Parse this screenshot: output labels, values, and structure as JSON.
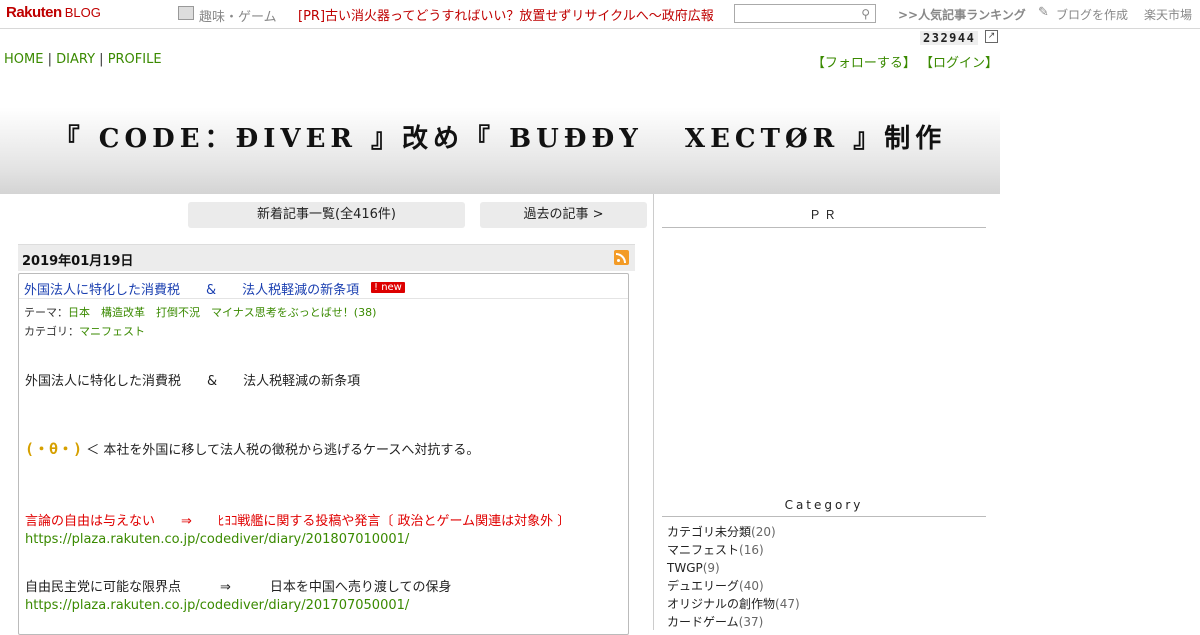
{
  "topbar": {
    "logo_main": "Rakuten",
    "logo_sub": "BLOG",
    "category_label": "趣味・ゲーム",
    "pr_link": "[PR]古い消火器ってどうすればいい？放置せずリサイクルへ～政府広報",
    "search_placeholder": "",
    "ranking_link": ">>人気記事ランキング",
    "create_link": "ブログを作成",
    "market_link": "楽天市場"
  },
  "counter": "232944",
  "nav": {
    "home": "HOME",
    "diary": "DIARY",
    "profile": "PROFILE",
    "sep": "|"
  },
  "account": {
    "follow": "【フォローする】",
    "login": "【ログイン】"
  },
  "banner": {
    "title": "『 CODE：ĐIVER 』改め『 BUĐĐY   XECTØR 』制作"
  },
  "buttons": {
    "new_list": "新着記事一覧(全416件)",
    "past": "過去の記事 >"
  },
  "entry": {
    "date": "2019年01月19日",
    "title": "外国法人に特化した消費税　　&　　法人税軽減の新条項",
    "new_badge": "! new",
    "theme_label": "テーマ：",
    "theme_value": "日本　構造改革　打倒不況　マイナス思考をぶっとばせ！(38)",
    "category_label": "カテゴリ：",
    "category_value": "マニフェスト",
    "body_heading": "外国法人に特化した消費税　　&　　法人税軽減の新条項",
    "face": "(・θ・)",
    "face_text": " ＜ 本社を外国に移して法人税の徴税から逃げるケースへ対抗する。",
    "red_line": "言論の自由は与えない　　⇒　　ﾋﾖｺ戦艦に関する投稿や発言〔 政治とゲーム関連は対象外 〕",
    "link1": "https://plaza.rakuten.co.jp/codediver/diary/201807010001/",
    "line2": "自由民主党に可能な限界点　　　⇒　　　日本を中国へ売り渡しての保身",
    "link2": "https://plaza.rakuten.co.jp/codediver/diary/201707050001/"
  },
  "sidebar": {
    "pr_heading": "ＰＲ",
    "category_heading": "Category",
    "categories": [
      {
        "name": "カテゴリ未分類",
        "count": "(20)"
      },
      {
        "name": "マニフェスト",
        "count": "(16)"
      },
      {
        "name": "TWGP",
        "count": "(9)"
      },
      {
        "name": "デュエリーグ",
        "count": "(40)"
      },
      {
        "name": "オリジナルの創作物",
        "count": "(47)"
      },
      {
        "name": "カードゲーム",
        "count": "(37)"
      }
    ]
  }
}
